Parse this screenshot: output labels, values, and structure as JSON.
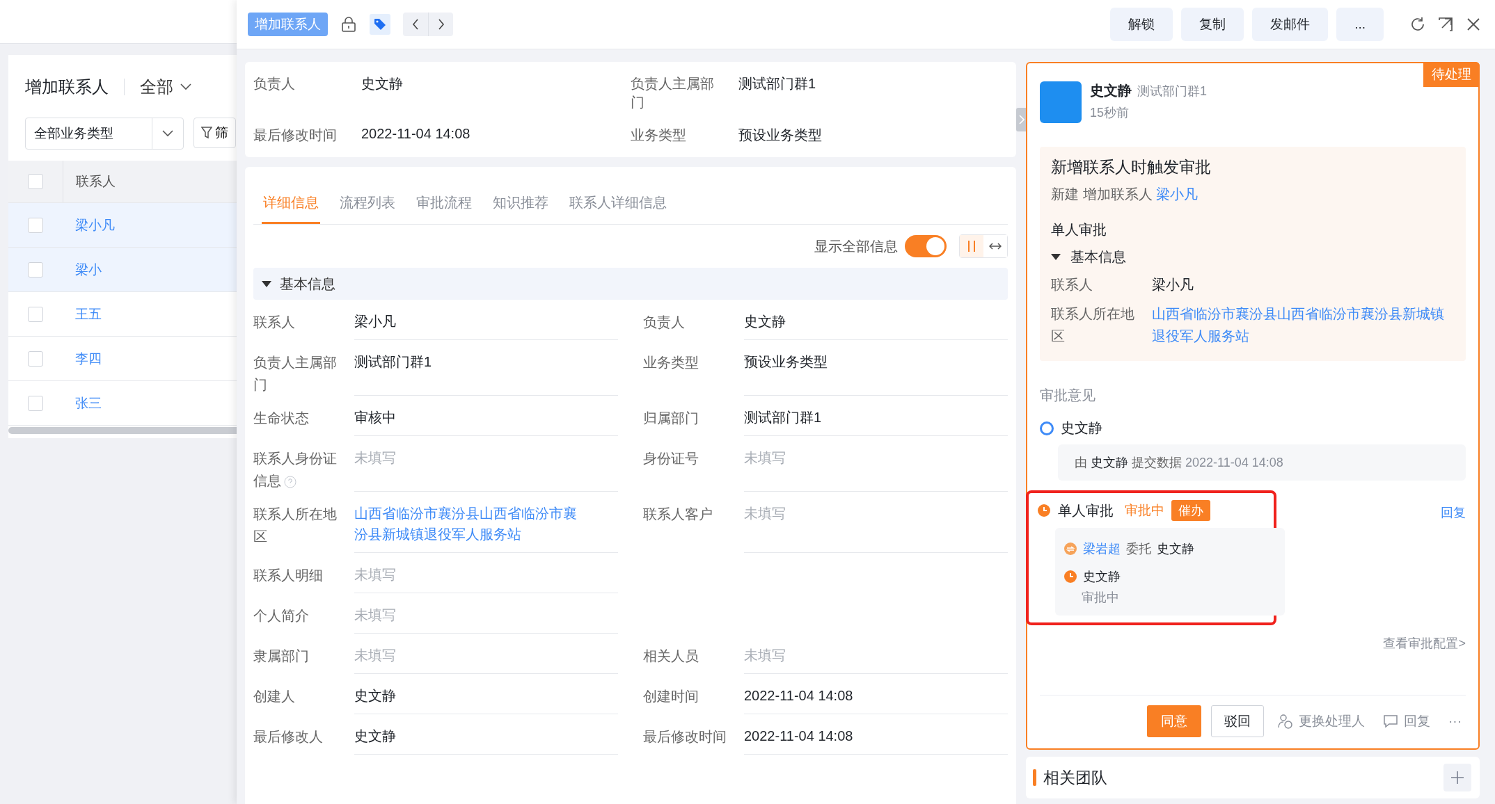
{
  "list_panel": {
    "title": "增加联系人",
    "scope": "全部",
    "type_filter": "全部业务类型",
    "filter_button": "筛",
    "all_checked": false,
    "column": "联系人",
    "rows": [
      {
        "name": "梁小凡",
        "selected": true,
        "checked": false
      },
      {
        "name": "梁小",
        "selected": true,
        "checked": false
      },
      {
        "name": "王五",
        "selected": false,
        "checked": false
      },
      {
        "name": "李四",
        "selected": false,
        "checked": false
      },
      {
        "name": "张三",
        "selected": false,
        "checked": false
      }
    ]
  },
  "header": {
    "badge": "增加联系人",
    "actions": [
      "解锁",
      "复制",
      "发邮件",
      "..."
    ]
  },
  "summary": [
    {
      "label": "负责人",
      "value": "史文静"
    },
    {
      "label": "负责人主属部门",
      "value": "测试部门群1"
    },
    {
      "label": "最后修改时间",
      "value": "2022-11-04 14:08"
    },
    {
      "label": "业务类型",
      "value": "预设业务类型"
    }
  ],
  "tabs": [
    {
      "label": "详细信息",
      "selected": true
    },
    {
      "label": "流程列表",
      "selected": false
    },
    {
      "label": "审批流程",
      "selected": false
    },
    {
      "label": "知识推荐",
      "selected": false
    },
    {
      "label": "联系人详细信息",
      "selected": false
    }
  ],
  "show_all": {
    "label": "显示全部信息",
    "on": true
  },
  "section": {
    "title": "基本信息",
    "expanded": true
  },
  "field_rows": [
    {
      "left": {
        "label": "联系人",
        "value": "梁小凡",
        "kind": "text"
      },
      "right": {
        "label": "负责人",
        "value": "史文静",
        "kind": "text"
      }
    },
    {
      "left": {
        "label": "负责人主属部门",
        "value": "测试部门群1",
        "kind": "text"
      },
      "right": {
        "label": "业务类型",
        "value": "预设业务类型",
        "kind": "text"
      }
    },
    {
      "left": {
        "label": "生命状态",
        "value": "审核中",
        "kind": "text"
      },
      "right": {
        "label": "归属部门",
        "value": "测试部门群1",
        "kind": "text"
      }
    },
    {
      "left": {
        "label": "联系人身份证信息",
        "value": "未填写",
        "kind": "empty",
        "help": true
      },
      "right": {
        "label": "身份证号",
        "value": "未填写",
        "kind": "empty"
      }
    },
    {
      "left": {
        "label": "联系人所在地区",
        "value": "山西省临汾市襄汾县山西省临汾市襄汾县新城镇退役军人服务站",
        "kind": "link"
      },
      "right": {
        "label": "联系人客户",
        "value": "未填写",
        "kind": "empty"
      }
    },
    {
      "left": {
        "label": "联系人明细",
        "value": "未填写",
        "kind": "empty"
      }
    },
    {
      "left": {
        "label": "个人简介",
        "value": "未填写",
        "kind": "empty"
      }
    },
    {
      "left": {
        "label": "隶属部门",
        "value": "未填写",
        "kind": "empty"
      },
      "right": {
        "label": "相关人员",
        "value": "未填写",
        "kind": "empty"
      }
    },
    {
      "left": {
        "label": "创建人",
        "value": "史文静",
        "kind": "text"
      },
      "right": {
        "label": "创建时间",
        "value": "2022-11-04 14:08",
        "kind": "text"
      }
    },
    {
      "left": {
        "label": "最后修改人",
        "value": "史文静",
        "kind": "text"
      },
      "right": {
        "label": "最后修改时间",
        "value": "2022-11-04 14:08",
        "kind": "text"
      }
    }
  ],
  "approval": {
    "status": "待处理",
    "user": "史文静",
    "dept": "测试部门群1",
    "time": "15秒前",
    "title": "新增联系人时触发审批",
    "subtitle": "新建 增加联系人",
    "subtitle_link": "梁小凡",
    "step": "单人审批",
    "section": {
      "title": "基本信息",
      "expanded": true
    },
    "fields": [
      {
        "label": "联系人",
        "value": "梁小凡",
        "kind": "text"
      },
      {
        "label": "联系人所在地区",
        "value": "山西省临汾市襄汾县山西省临汾市襄汾县新城镇退役军人服务站",
        "kind": "link"
      }
    ],
    "opinions_label": "审批意见",
    "submitted": {
      "name": "史文静",
      "prefix": "由",
      "by": "史文静",
      "action": "提交数据",
      "time": "2022-11-04 14:08"
    },
    "current": {
      "step": "单人审批",
      "status": "审批中",
      "urge": "催办",
      "reply": "回复",
      "highlighted": true,
      "entries": [
        {
          "kind": "delegate",
          "from": "梁岩超",
          "verb": "委托",
          "to": "史文静"
        },
        {
          "kind": "pending",
          "name": "史文静",
          "status": "审批中"
        }
      ]
    },
    "config_link": "查看审批配置>",
    "buttons": [
      {
        "label": "同意",
        "kind": "primary"
      },
      {
        "label": "驳回",
        "kind": "outline"
      },
      {
        "label": "更换处理人",
        "kind": "swap"
      },
      {
        "label": "回复",
        "kind": "comment"
      },
      {
        "label": "···",
        "kind": "more"
      }
    ]
  },
  "team": {
    "title": "相关团队"
  }
}
